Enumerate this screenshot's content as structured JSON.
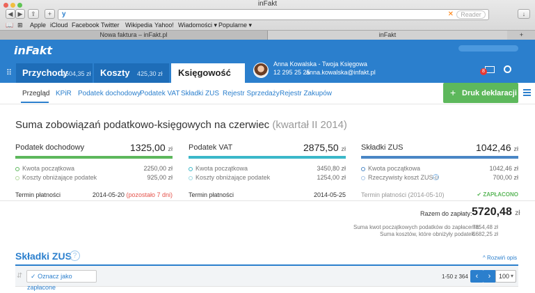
{
  "browser": {
    "window_title": "inFakt",
    "reader_label": "Reader",
    "bookmarks": [
      "Apple",
      "iCloud",
      "Facebook",
      "Twitter",
      "Wikipedia",
      "Yahoo!",
      "Wiadomości ▾",
      "Popularne ▾"
    ],
    "tabs": [
      "Nowa faktura – inFakt.pl",
      "inFakt"
    ]
  },
  "app": {
    "logo": "inFakt",
    "nav": [
      {
        "label": "Przychody",
        "amount": "2504,35 zł"
      },
      {
        "label": "Koszty",
        "amount": "425,30 zł"
      },
      {
        "label": "Księgowość",
        "amount": ""
      }
    ],
    "accountant": {
      "name": "Anna Kowalska - Twoja Księgowa",
      "phone": "12 295 25 25",
      "email": "anna.kowalska@infakt.pl"
    },
    "notification_count": "8"
  },
  "subnav": {
    "items": [
      "Przegląd",
      "KPiR",
      "Podatek dochodowy",
      "Podatek VAT",
      "Składki ZUS",
      "Rejestr Sprzedaży",
      "Rejestr Zakupów"
    ],
    "action_button": "Druk deklaracji"
  },
  "summary": {
    "title": "Suma zobowiązań podatkowo-księgowych na czerwiec",
    "period": "(kwartał II 2014)",
    "currency": "zł",
    "columns": [
      {
        "name": "Podatek dochodowy",
        "total": "1325,00",
        "bar_color": "#5db85c",
        "rows": [
          {
            "label": "Kwota początkowa",
            "value": "2250,00 zł",
            "dot": "#5db85c"
          },
          {
            "label": "Koszty obniżające podatek",
            "value": "925,00 zł",
            "dot": "#b5d7a0"
          }
        ],
        "term_label": "Termin płatności",
        "term_date": "2014-05-20",
        "term_note": "(pozostało 7 dni)",
        "status": ""
      },
      {
        "name": "Podatek VAT",
        "total": "2875,50",
        "bar_color": "#3bb8c9",
        "rows": [
          {
            "label": "Kwota początkowa",
            "value": "3450,80 zł",
            "dot": "#3bb8c9"
          },
          {
            "label": "Koszty obniżające podatek",
            "value": "1254,00 zł",
            "dot": "#9edbe4"
          }
        ],
        "term_label": "Termin płatności",
        "term_date": "2014-05-25",
        "term_note": "",
        "status": ""
      },
      {
        "name": "Składki ZUS",
        "total": "1042,46",
        "bar_color": "#4a86c5",
        "rows": [
          {
            "label": "Kwota początkowa",
            "value": "1042,46 zł",
            "dot": "#4a86c5"
          },
          {
            "label": "Rzeczywisty koszt ZUS-u",
            "value": "700,00 zł",
            "dot": "#a7c5e6"
          }
        ],
        "term_label": "Termin płatności (2014-05-10)",
        "term_date": "",
        "term_note": "",
        "status": "ZAPŁACONO"
      }
    ],
    "total_label": "Razem do zapłaty:",
    "total_value": "5720,48",
    "sub_lines": [
      {
        "label": "Suma kwot początkowych podatków do zapłacenia:",
        "value": "7854,48 zł"
      },
      {
        "label": "Suma kosztów, które obniżyły podatek:",
        "value": "5682,25 zł"
      }
    ]
  },
  "zus": {
    "heading": "Składki ZUS",
    "expand_label": "Rozwiń opis",
    "mark_paid": "Oznacz jako zapłacone",
    "pagination": "1-50 z 364",
    "per_page": "100"
  }
}
